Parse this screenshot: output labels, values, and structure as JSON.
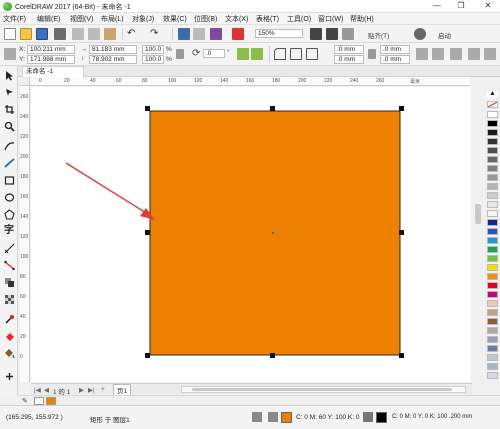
{
  "window": {
    "title": "CorelDRAW 2017 (64-Bit) - 未命名 -1",
    "minimize": "—",
    "restore": "❐",
    "close": "✕"
  },
  "menu": [
    "文件(F)",
    "编辑(E)",
    "视图(V)",
    "布局(L)",
    "对象(J)",
    "效果(C)",
    "位图(B)",
    "文本(X)",
    "表格(T)",
    "工具(O)",
    "窗口(W)",
    "帮助(H)"
  ],
  "toolbar": {
    "zoom": "150%",
    "snap_label": "贴齐(T)",
    "launch_label": "启动"
  },
  "property_bar": {
    "x_label": "X:",
    "x_value": "100.211 mm",
    "y_label": "Y:",
    "y_value": "171.988 mm",
    "width_value": "81.183 mm",
    "height_value": "78.902 mm",
    "scale_x": "100.0",
    "scale_y": "100.0",
    "percent": "%",
    "rotation": ".0",
    "degree": "°",
    "corner_1": ".0 mm",
    "corner_2": ".0 mm",
    "outline_1": ".0 mm",
    "outline_2": ".0 mm"
  },
  "document": {
    "tab_label": "未命名 -1",
    "page_counter": "1 的 1",
    "page_tab": "页1"
  },
  "ruler": {
    "h_ticks": [
      "0",
      "20",
      "40",
      "60",
      "80",
      "100",
      "120",
      "140",
      "160",
      "180",
      "200",
      "220",
      "240",
      "260"
    ],
    "v_ticks": [
      "260",
      "240",
      "220",
      "200",
      "180",
      "160",
      "140",
      "120",
      "100",
      "80",
      "60",
      "40",
      "20",
      "0"
    ],
    "unit": "毫米"
  },
  "shape": {
    "fill_color": "#ee8000",
    "outline_color": "#2a2a2a"
  },
  "status": {
    "coords": "(165.295, 155.972 )",
    "object_info": "矩形 于 图层1",
    "fill_info": "C: 0 M: 60 Y: 100 K: 0",
    "outline_info": "C: 0 M: 0 Y: 0 K: 100 .200 mm"
  },
  "colors": {
    "accent": "#ee8000",
    "arrow": "#e53935"
  },
  "palette": [
    "#ffffff",
    "#000000",
    "#1a1a1a",
    "#333333",
    "#4d4d4d",
    "#666666",
    "#808080",
    "#999999",
    "#b3b3b3",
    "#cccccc",
    "#e6e6e6",
    "#f2f2f2",
    "#1f1f8f",
    "#2356c7",
    "#1a9ad6",
    "#17a84a",
    "#74c043",
    "#f5e000",
    "#f29100",
    "#e2001a",
    "#c8007a",
    "#f7c6a6",
    "#c8a27e",
    "#8b5e3c",
    "#b7a99a",
    "#9aa0b8",
    "#6c7aa8",
    "#c2c7d6",
    "#a6b4c8",
    "#d6d9e3"
  ]
}
